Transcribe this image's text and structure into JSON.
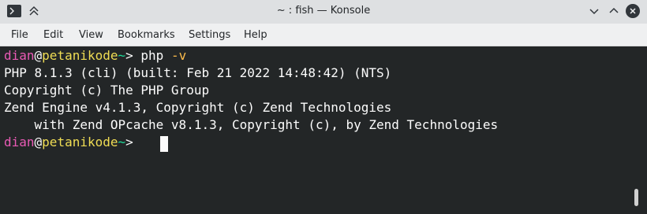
{
  "window": {
    "title": "~ : fish — Konsole"
  },
  "menu": {
    "items": [
      "File",
      "Edit",
      "View",
      "Bookmarks",
      "Settings",
      "Help"
    ]
  },
  "terminal": {
    "prompt1": {
      "user": "dian",
      "at": "@",
      "host": "petanikode",
      "path": "~",
      "symbol": "> ",
      "command": "php",
      "arg": " -v"
    },
    "output": [
      "PHP 8.1.3 (cli) (built: Feb 21 2022 14:48:42) (NTS)",
      "Copyright (c) The PHP Group",
      "Zend Engine v4.1.3, Copyright (c) Zend Technologies",
      "    with Zend OPcache v8.1.3, Copyright (c), by Zend Technologies"
    ],
    "prompt2": {
      "user": "dian",
      "at": "@",
      "host": "petanikode",
      "path": "~",
      "symbol": "> "
    }
  },
  "colors": {
    "terminal_bg": "#232627",
    "user": "#e95ab5",
    "host": "#f0dd54",
    "path": "#1cdc9a",
    "arg": "#fdbc4b",
    "text": "#fcfcfc"
  },
  "icons": {
    "app": "terminal-icon",
    "keep_above": "keep-above-icon",
    "minimize": "minimize-icon",
    "maximize": "maximize-icon",
    "close": "close-icon"
  }
}
